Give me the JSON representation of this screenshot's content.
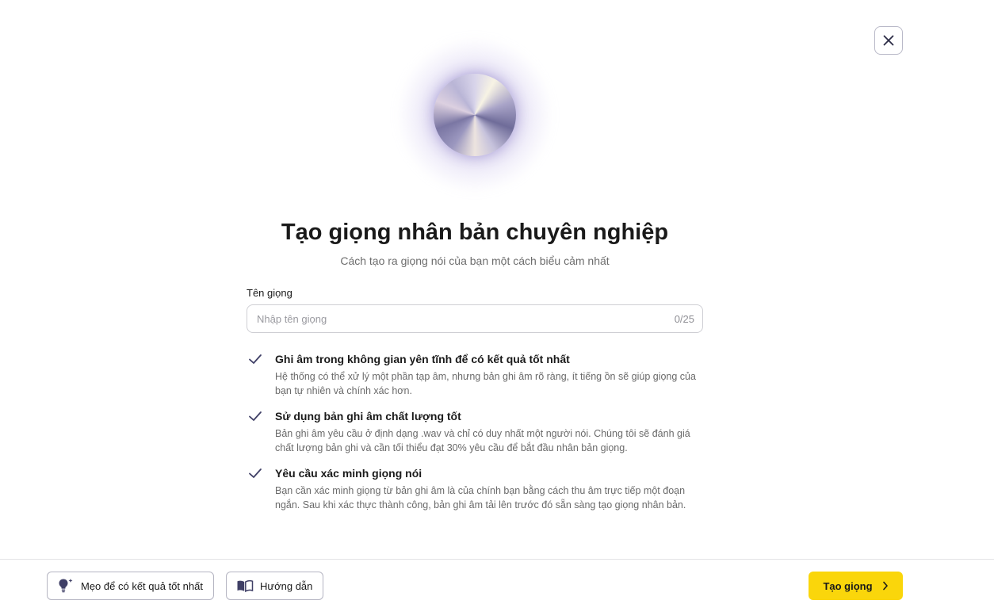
{
  "header": {
    "close_icon": "close-icon"
  },
  "hero": {
    "title": "Tạo giọng nhân bản chuyên nghiệp",
    "subtitle": "Cách tạo ra giọng nói của bạn một cách biểu cảm nhất"
  },
  "form": {
    "voice_name_label": "Tên giọng",
    "voice_name_placeholder": "Nhập tên giọng",
    "voice_name_value": "",
    "counter": "0/25"
  },
  "tips": [
    {
      "title": "Ghi âm trong không gian yên tĩnh để có kết quả tốt nhất",
      "desc": "Hệ thống có thể xử lý một phần tạp âm, nhưng bản ghi âm rõ ràng, ít tiếng ồn sẽ giúp giọng của bạn tự nhiên và chính xác hơn."
    },
    {
      "title": "Sử dụng bản ghi âm chất lượng tốt",
      "desc": "Bản ghi âm yêu cầu ở định dạng .wav và chỉ có duy nhất một người nói. Chúng tôi sẽ đánh giá chất lượng bản ghi và cần tối thiểu đạt 30% yêu cầu để bắt đầu nhân bản giọng."
    },
    {
      "title": "Yêu cầu xác minh giọng nói",
      "desc": "Bạn cần xác minh giọng từ bản ghi âm là của chính bạn bằng cách thu âm trực tiếp một đoạn ngắn. Sau khi xác thực thành công, bản ghi âm tải lên trước đó sẵn sàng tạo giọng nhân bản."
    }
  ],
  "footer": {
    "tips_label": "Mẹo để có kết quả tốt nhất",
    "guide_label": "Hướng dẫn",
    "create_label": "Tạo giọng"
  },
  "colors": {
    "primary": "#fad60b",
    "check": "#3f3f66",
    "border": "#cfcfd4"
  }
}
